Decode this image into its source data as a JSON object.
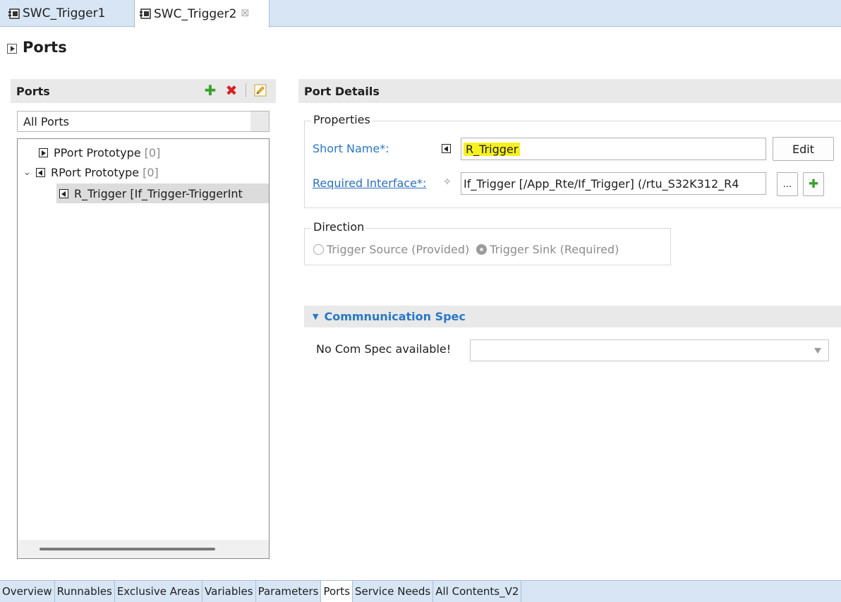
{
  "editor_tabs": [
    {
      "label": "SWC_Trigger1",
      "active": false,
      "icon": "component-icon"
    },
    {
      "label": "SWC_Trigger2",
      "active": true,
      "icon": "component-icon",
      "close_glyph": "☒"
    }
  ],
  "page": {
    "title": "Ports",
    "icon": "expand-section-icon"
  },
  "ports_panel": {
    "title": "Ports",
    "toolbar": {
      "add_icon": "✚",
      "delete_icon": "✖",
      "edit_icon": "pencil-icon"
    },
    "filter_value": "All Ports",
    "tree": [
      {
        "label": "PPort Prototype",
        "count": "[0]",
        "icon": "pport-icon",
        "expanded": false
      },
      {
        "label": "RPort Prototype",
        "count": "[0]",
        "icon": "rport-icon",
        "expanded": true,
        "twisty": "⌄"
      },
      {
        "label": "R_Trigger [If_Trigger-TriggerInt",
        "icon": "rport-icon",
        "selected": true
      }
    ]
  },
  "port_details": {
    "title": "Port Details",
    "properties": {
      "group_label": "Properties",
      "short_name_label": "Short Name*:",
      "short_name_value": "R_Trigger",
      "edit_button": "Edit",
      "required_interface_label": "Required Interface*:",
      "required_interface_value": "If_Trigger [/App_Rte/If_Trigger] (/rtu_S32K312_R4",
      "browse_button": "...",
      "add_button": "✚"
    },
    "direction": {
      "group_label": "Direction",
      "options": [
        {
          "label": "Trigger Source (Provided)",
          "checked": false
        },
        {
          "label": "Trigger Sink (Required)",
          "checked": true
        }
      ]
    },
    "com_spec": {
      "header": "Commnunication Spec",
      "label": "No Com Spec available!",
      "value": ""
    }
  },
  "bottom_tabs": [
    {
      "label": "Overview",
      "active": false
    },
    {
      "label": "Runnables",
      "active": false
    },
    {
      "label": "Exclusive Areas",
      "active": false
    },
    {
      "label": "Variables",
      "active": false
    },
    {
      "label": "Parameters",
      "active": false
    },
    {
      "label": "Ports",
      "active": true
    },
    {
      "label": "Service Needs",
      "active": false
    },
    {
      "label": "All Contents_V2",
      "active": false
    }
  ],
  "colors": {
    "accent": "#2a78c8",
    "highlight": "#f7f020",
    "tab_bar": "#d7e5f4",
    "add": "#38a32a",
    "delete": "#d82222"
  }
}
